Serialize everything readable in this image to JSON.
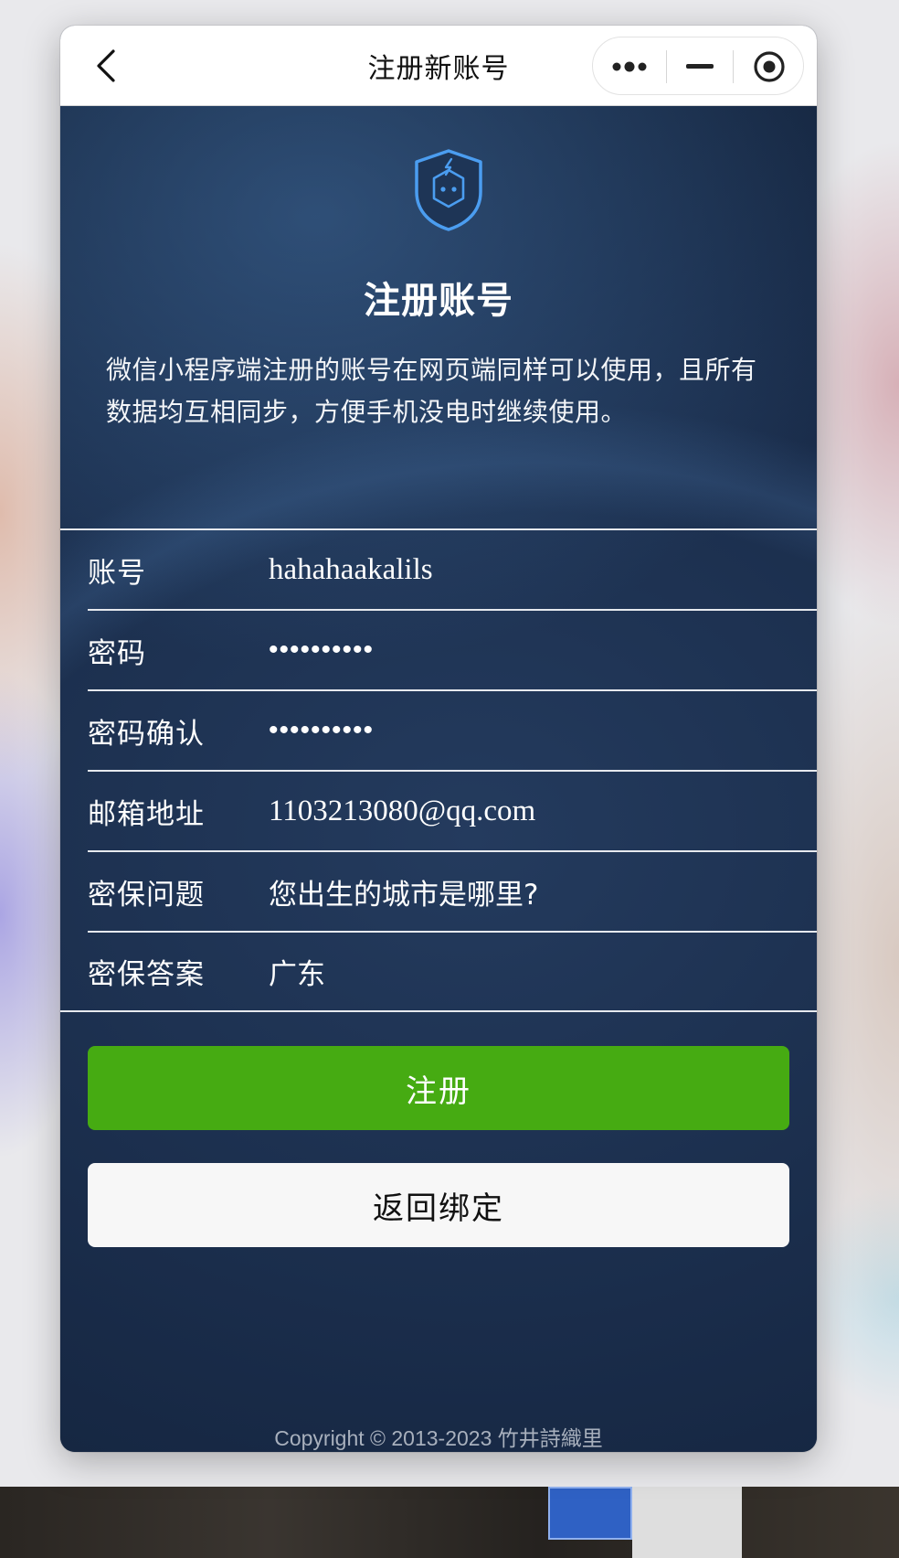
{
  "navbar": {
    "title": "注册新账号",
    "back_icon": "chevron-left-icon",
    "capsule": {
      "more_icon": "more-dots-icon",
      "minimize_icon": "minimize-icon",
      "close_icon": "record-circle-icon"
    }
  },
  "hero": {
    "logo_icon": "shield-robot-icon",
    "title": "注册账号",
    "description": "微信小程序端注册的账号在网页端同样可以使用，且所有数据均互相同步，方便手机没电时继续使用。"
  },
  "form": {
    "fields": [
      {
        "label": "账号",
        "value": "hahahaakalils"
      },
      {
        "label": "密码",
        "value": "••••••••••"
      },
      {
        "label": "密码确认",
        "value": "••••••••••"
      },
      {
        "label": "邮箱地址",
        "value": "1103213080@qq.com"
      },
      {
        "label": "密保问题",
        "value": "您出生的城市是哪里?"
      },
      {
        "label": "密保答案",
        "value": "广东"
      }
    ]
  },
  "buttons": {
    "register": "注册",
    "back_bind": "返回绑定"
  },
  "footer": {
    "copyright": "Copyright © 2013-2023 竹井詩織里"
  },
  "colors": {
    "primary_green": "#46ab12",
    "background_navy": "#1b2d4b",
    "logo_blue": "#4b9df0"
  }
}
